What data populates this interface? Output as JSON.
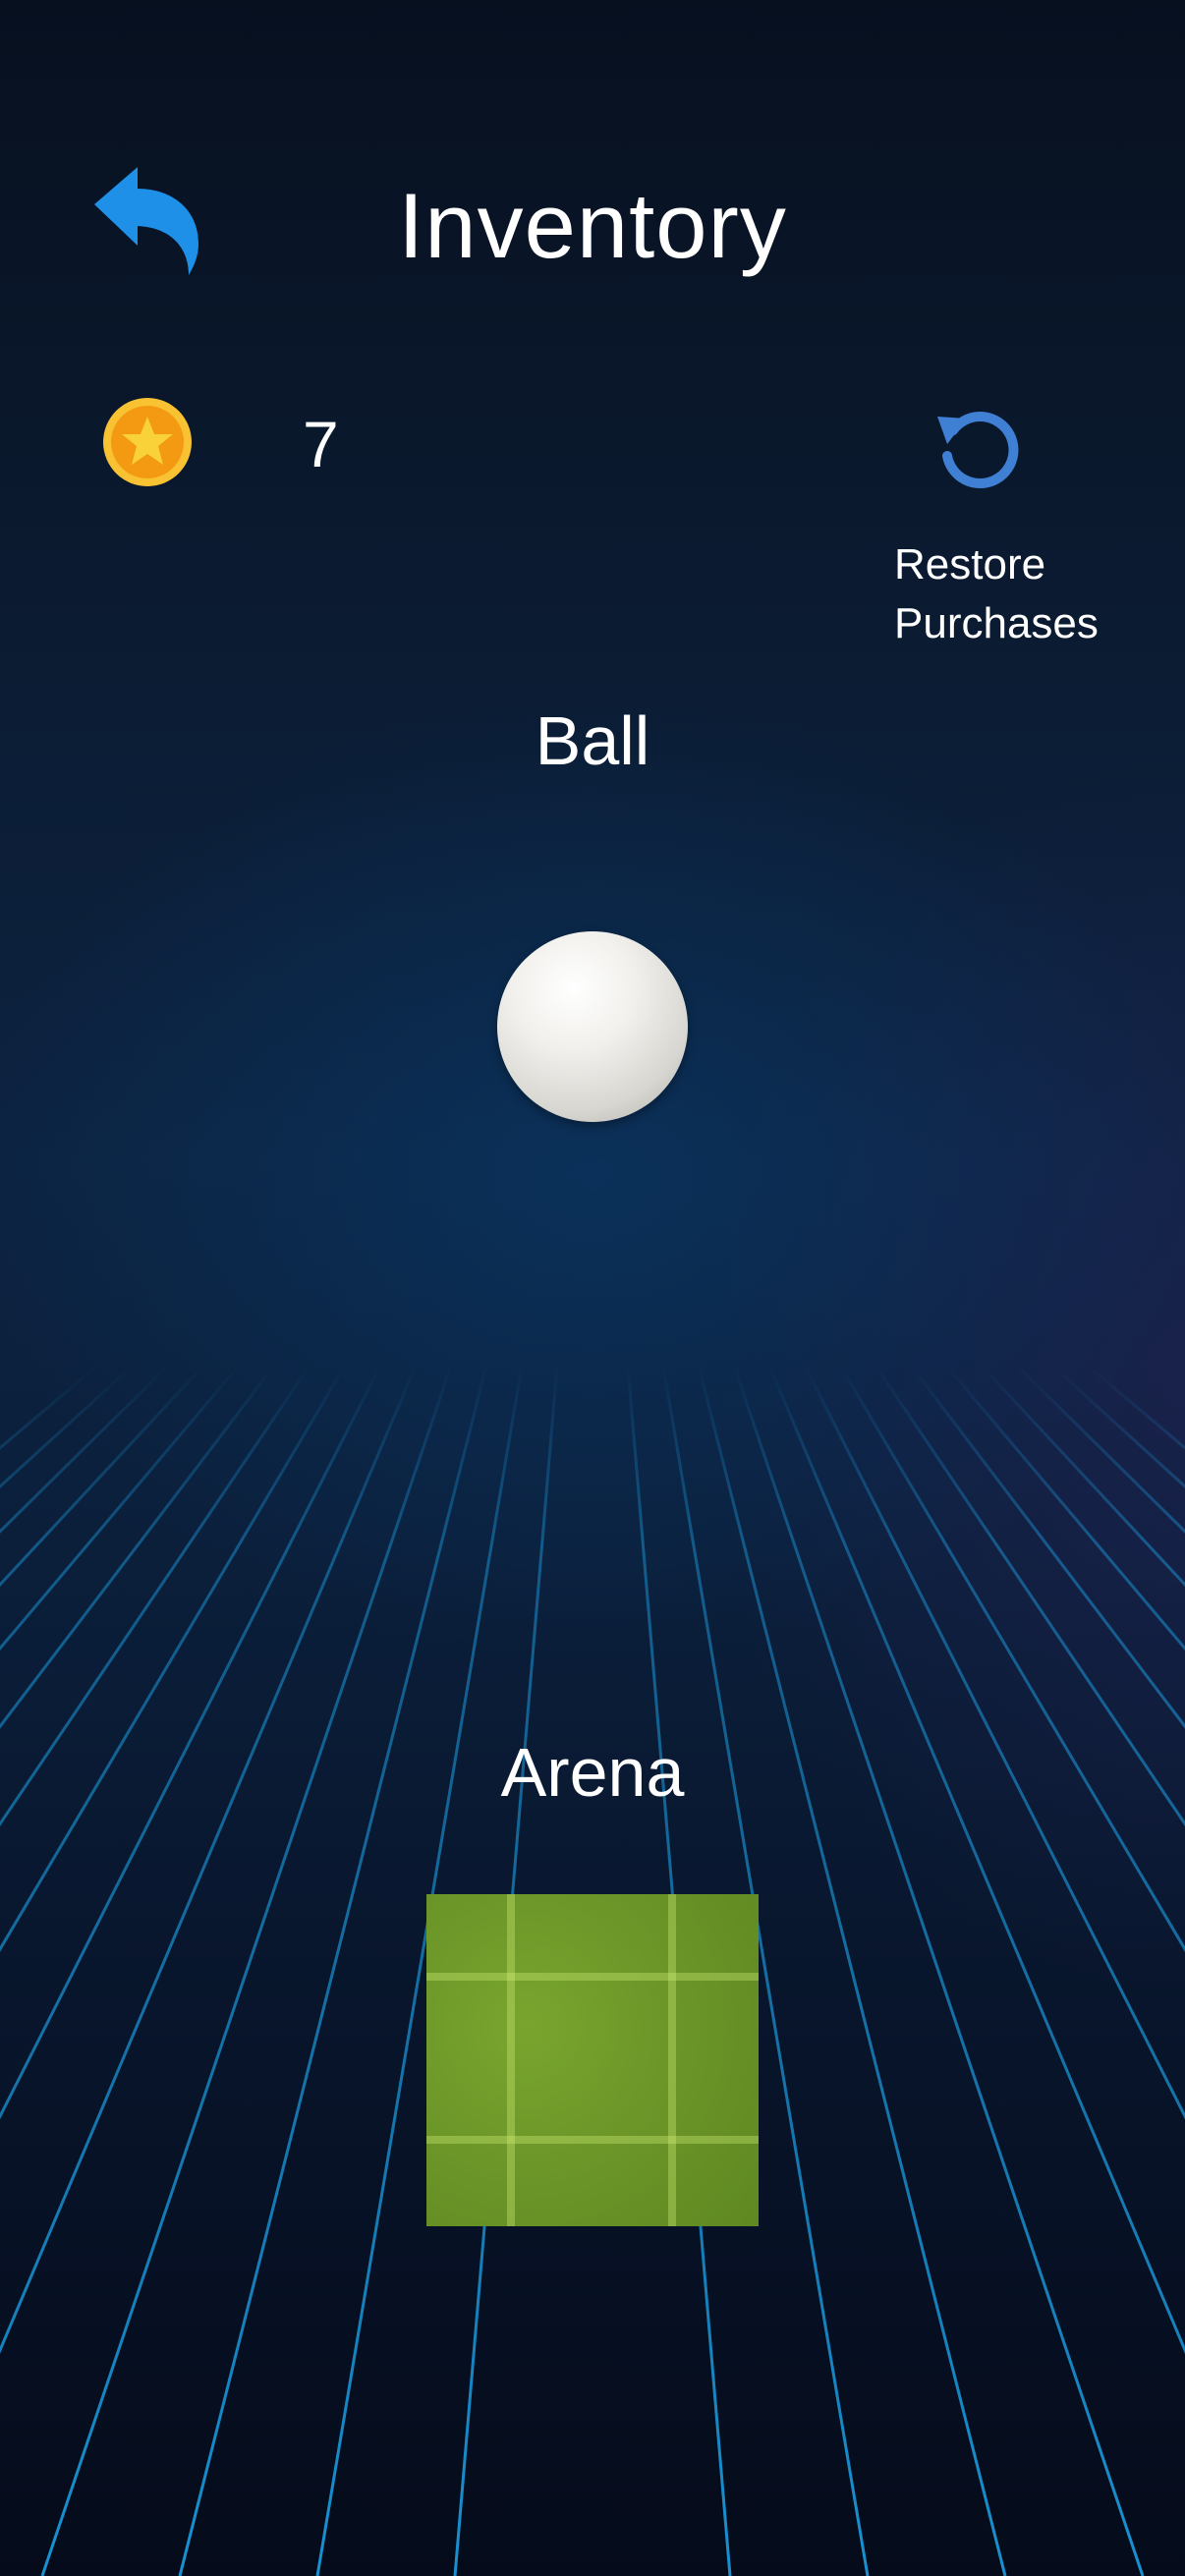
{
  "header": {
    "title": "Inventory",
    "back_icon": "back-arrow-icon"
  },
  "currency": {
    "icon": "star-coin-icon",
    "count": "7"
  },
  "restore": {
    "icon": "restore-circular-arrow-icon",
    "label": "Restore\nPurchases"
  },
  "sections": {
    "ball_label": "Ball",
    "arena_label": "Arena"
  },
  "colors": {
    "accent_blue": "#1e90e8",
    "restore_blue": "#3f7fd4",
    "coin_orange": "#f39a12",
    "coin_yellow": "#f9d23a",
    "grid_line": "#1aa0e6"
  }
}
